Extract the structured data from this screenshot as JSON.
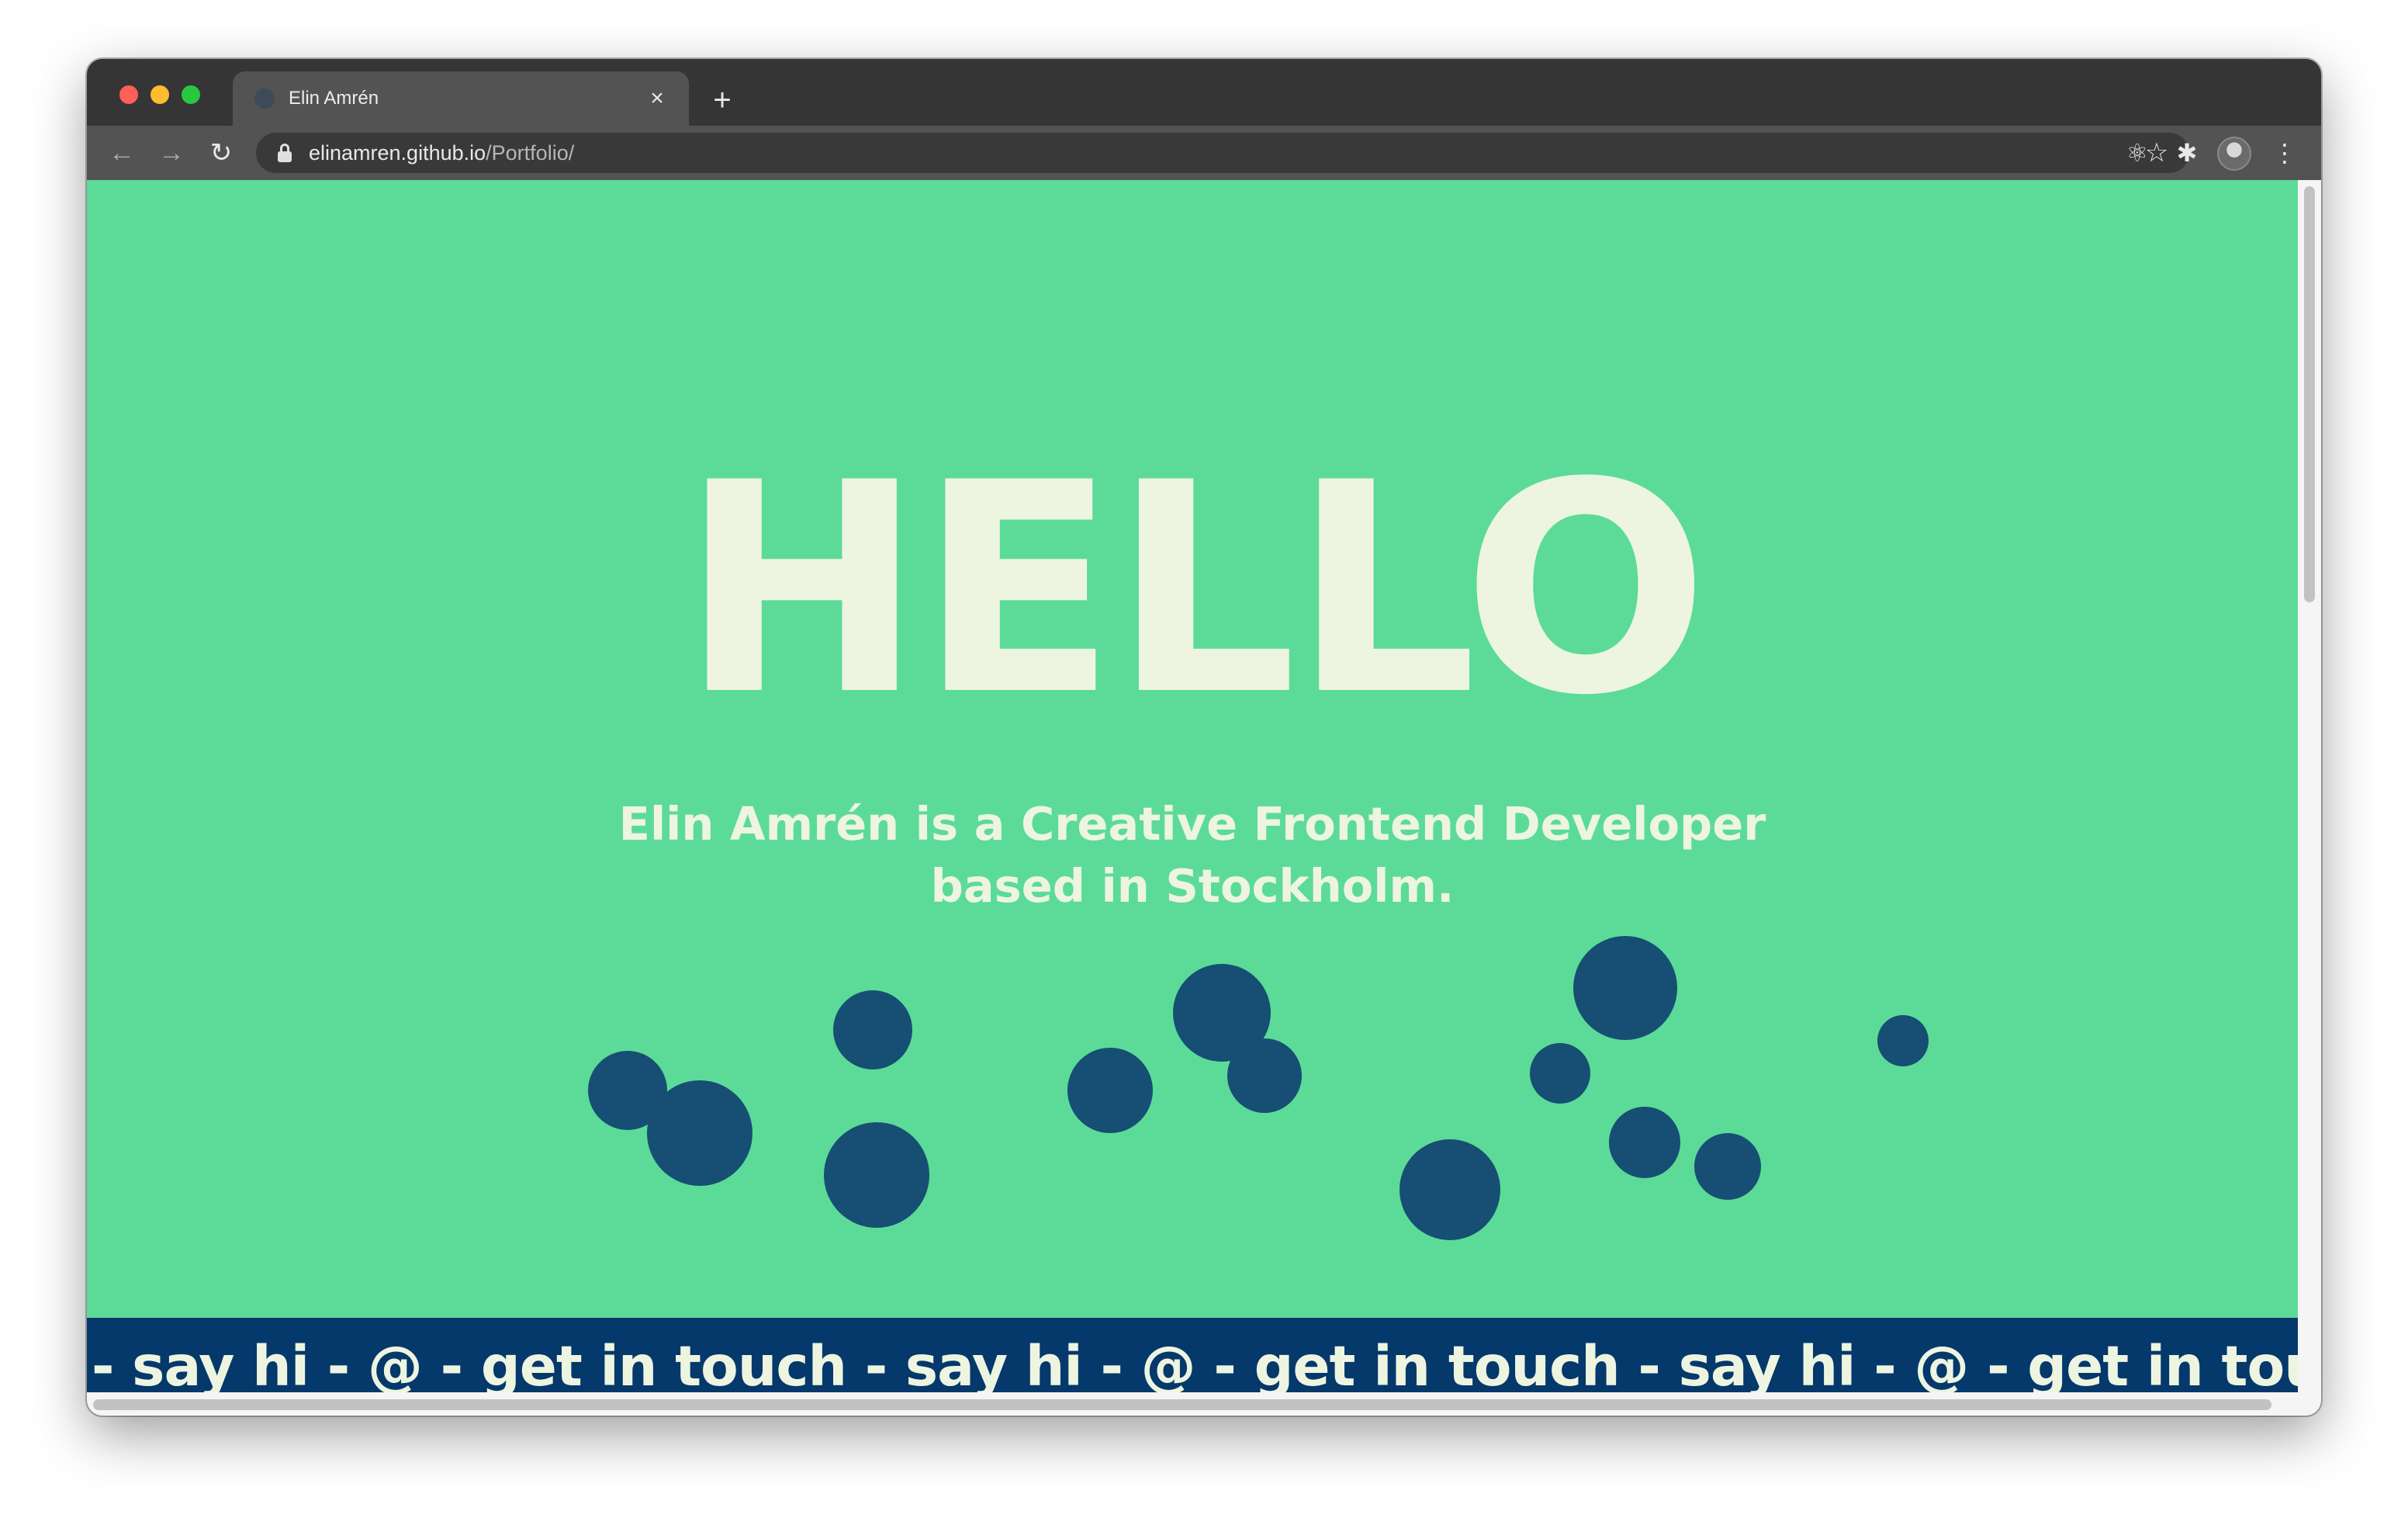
{
  "browser": {
    "tab": {
      "title": "Elin Amrén",
      "close_glyph": "×"
    },
    "new_tab_glyph": "+",
    "nav": {
      "back_glyph": "←",
      "forward_glyph": "→",
      "reload_glyph": "↻"
    },
    "url": {
      "host": "elinamren.github.io",
      "path": "/Portfolio/"
    },
    "icons": {
      "star": "☆",
      "react_devtools": "⚛",
      "extensions": "✱",
      "menu": "⋮"
    }
  },
  "page": {
    "heading": "HELLO",
    "subtitle_line1": "Elin Amrén is a Creative Frontend Developer",
    "subtitle_line2": "based in Stockholm.",
    "marquee": "- say hi - @ - get in touch - say hi - @ - get in touch - say hi - @ - get in touch -"
  },
  "colors": {
    "background": "#5cdb98",
    "text_light": "#edf5e1",
    "bubble": "#164f73",
    "marquee_bg": "#05386b"
  }
}
